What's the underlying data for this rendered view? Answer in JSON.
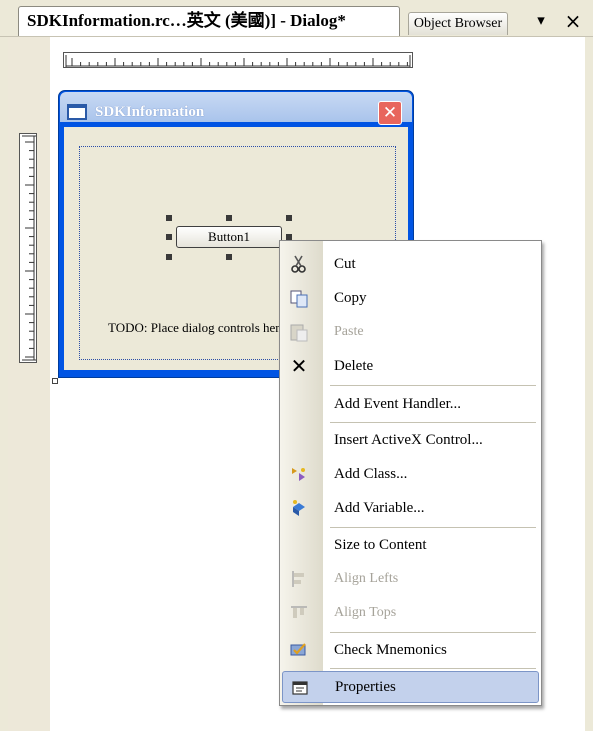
{
  "tabs": {
    "active_title": "SDKInformation.rc…英文 (美國)] - Dialog*",
    "inactive_title": "Object Browser",
    "dropdown_icon": "▾",
    "close_icon": "×"
  },
  "dialog": {
    "title": "SDKInformation",
    "close_glyph": "✕",
    "button_label": "Button1",
    "todo_text": "TODO: Place dialog controls here."
  },
  "context_menu": {
    "items": [
      {
        "label": "Cut",
        "icon": "cut-icon",
        "enabled": true
      },
      {
        "label": "Copy",
        "icon": "copy-icon",
        "enabled": true
      },
      {
        "label": "Paste",
        "icon": "paste-icon",
        "enabled": false
      },
      {
        "label": "Delete",
        "icon": "delete-icon",
        "enabled": true
      },
      {
        "label": "Add Event Handler...",
        "icon": "",
        "enabled": true
      },
      {
        "label": "Insert ActiveX Control...",
        "icon": "",
        "enabled": true
      },
      {
        "label": "Add Class...",
        "icon": "add-class-icon",
        "enabled": true
      },
      {
        "label": "Add Variable...",
        "icon": "add-variable-icon",
        "enabled": true
      },
      {
        "label": "Size to Content",
        "icon": "",
        "enabled": true
      },
      {
        "label": "Align Lefts",
        "icon": "align-lefts-icon",
        "enabled": false
      },
      {
        "label": "Align Tops",
        "icon": "align-tops-icon",
        "enabled": false
      },
      {
        "label": "Check Mnemonics",
        "icon": "check-mnemonics-icon",
        "enabled": true
      },
      {
        "label": "Properties",
        "icon": "properties-icon",
        "enabled": true,
        "highlighted": true
      }
    ]
  },
  "colors": {
    "xp_blue": "#0054e3",
    "menu_highlight": "#c3d1ec",
    "dialog_client": "#ece9d8"
  }
}
